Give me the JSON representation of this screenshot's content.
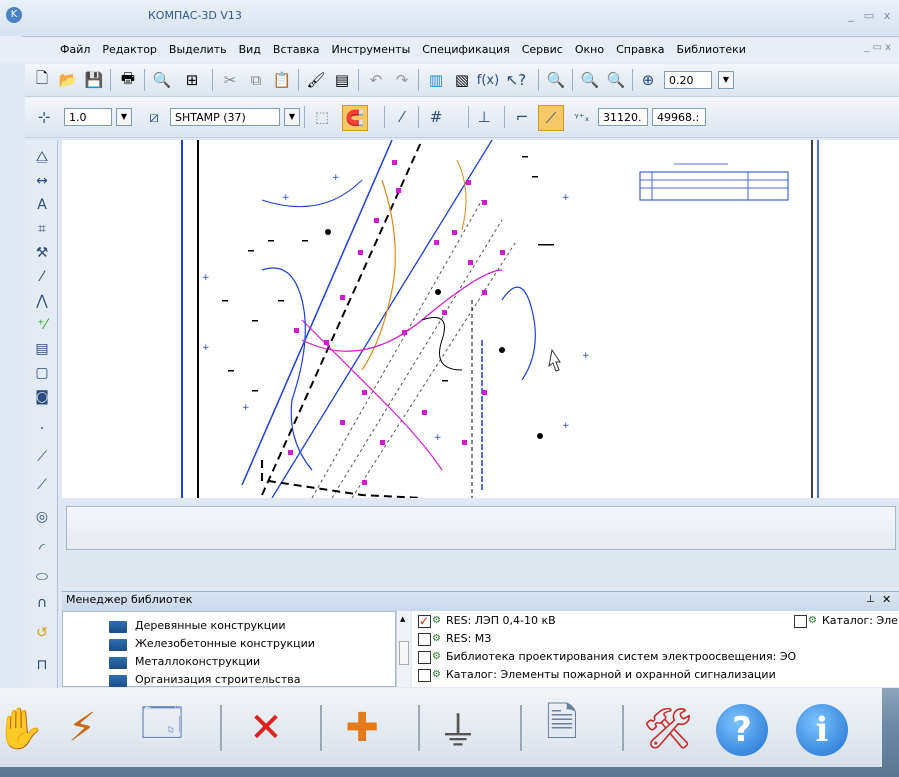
{
  "window": {
    "title": "КОМПАС-3D V13"
  },
  "menu": [
    "Файл",
    "Редактор",
    "Выделить",
    "Вид",
    "Вставка",
    "Инструменты",
    "Спецификация",
    "Сервис",
    "Окно",
    "Справка",
    "Библиотеки"
  ],
  "toolbar_standard": {
    "zoom_value": "0.20"
  },
  "toolbar_current": {
    "scale_value": "1.0",
    "layer_value": "SHTAMP (37)",
    "coord_x": "31120.",
    "coord_y": "49968.:"
  },
  "library_manager": {
    "title": "Менеджер библиотек",
    "folders": [
      "Деревянные конструкции",
      "Железобетонные конструкции",
      "Металлоконструкции",
      "Организация строительства"
    ],
    "libraries": [
      {
        "label": "RES: ЛЭП 0,4-10 кВ",
        "checked": true
      },
      {
        "label": "RES: МЗ",
        "checked": false
      },
      {
        "label": "Библиотека проектирования систем электроосвещения: ЭО",
        "checked": false
      },
      {
        "label": "Каталог: Элементы пожарной и охранной сигнализации",
        "checked": false
      }
    ],
    "catalog_right": "Каталог: Эле"
  },
  "icons": {
    "taskbar": [
      "hand-power-icon",
      "lightning-line-icon",
      "window-hand-icon",
      "cross-star-icon",
      "cross-light-icon",
      "ground-lightning-icon",
      "document-icon",
      "tools-icon",
      "help-icon",
      "info-icon"
    ]
  },
  "colors": {
    "accent": "#2f6fb6",
    "magenta": "#d21cd2",
    "blue_line": "#1f3fd6",
    "orange": "#d98a1a"
  }
}
